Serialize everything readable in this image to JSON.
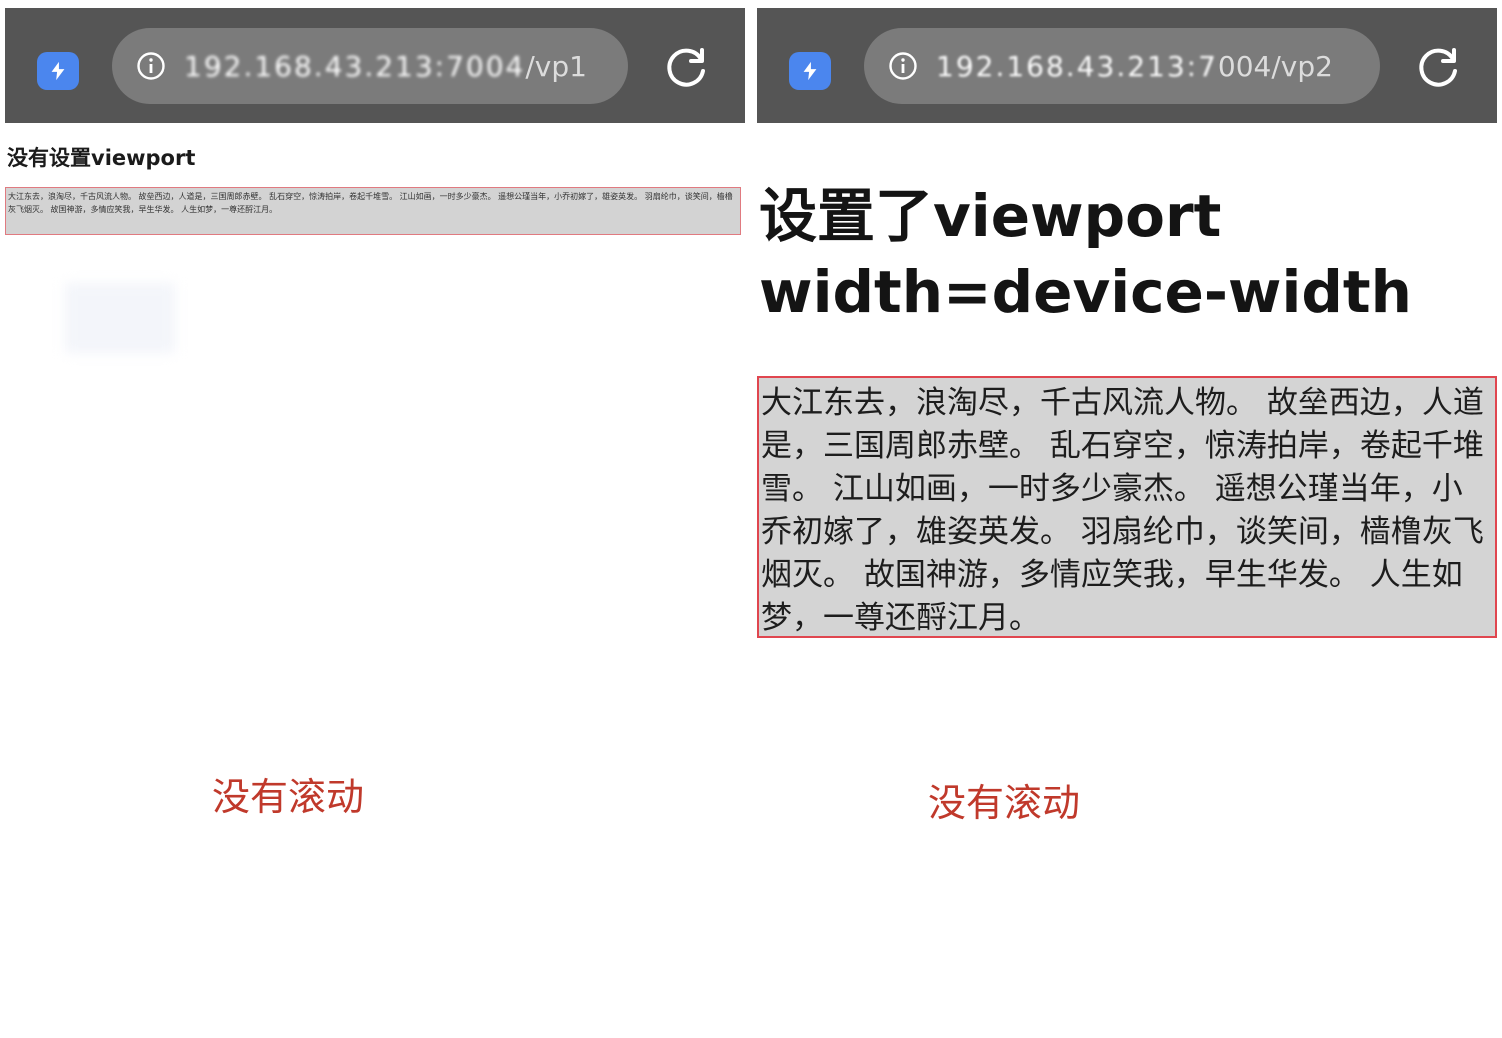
{
  "left_panel": {
    "browser": {
      "url_host": "192.168.43.213:7004",
      "url_path": "/vp1"
    },
    "heading": "没有设置viewport",
    "poem": "大江东去，浪淘尽，千古风流人物。 故垒西边，人道是，三国周郎赤壁。 乱石穿空，惊涛拍岸，卷起千堆雪。 江山如画，一时多少豪杰。 遥想公瑾当年，小乔初嫁了，雄姿英发。 羽扇纶巾，谈笑间，樯橹灰飞烟灭。 故国神游，多情应笑我，早生华发。 人生如梦，一尊还酹江月。",
    "caption": "没有滚动"
  },
  "right_panel": {
    "browser": {
      "url_host": "192.168.43.213:7",
      "url_path": "004/vp2"
    },
    "heading_line1": "设置了viewport",
    "heading_line2": "width=device-width",
    "poem": "大江东去，浪淘尽，千古风流人物。 故垒西边，人道是，三国周郎赤壁。 乱石穿空，惊涛拍岸，卷起千堆雪。 江山如画，一时多少豪杰。 遥想公瑾当年，小乔初嫁了，雄姿英发。 羽扇纶巾，谈笑间，樯橹灰飞烟灭。 故国神游，多情应笑我，早生华发。 人生如梦，一尊还酹江月。",
    "caption": "没有滚动"
  },
  "icons": {
    "app_badge": "lightning-bolt-icon",
    "info": "info-circle-icon",
    "reload": "reload-icon"
  },
  "colors": {
    "browser_bar": "#555555",
    "url_pill": "#7b7b7b",
    "app_badge": "#4b86ee",
    "poem_background": "#d4d4d4",
    "poem_border": "#e0464f",
    "caption_text": "#c0392b"
  }
}
